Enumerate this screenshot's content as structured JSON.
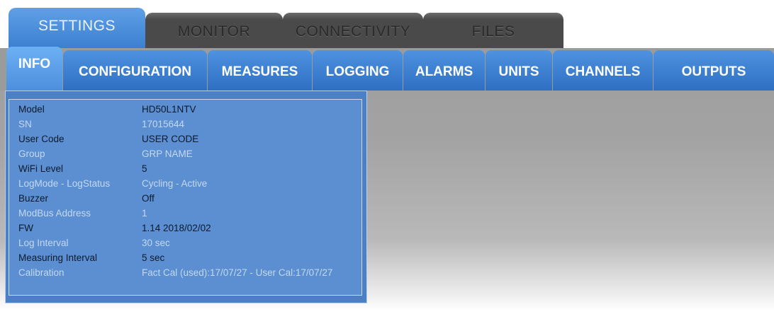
{
  "top_tabs": [
    {
      "label": "SETTINGS"
    },
    {
      "label": "MONITOR"
    },
    {
      "label": "CONNECTIVITY"
    },
    {
      "label": "FILES"
    }
  ],
  "sub_tabs": [
    {
      "label": "INFO"
    },
    {
      "label": "CONFIGURATION"
    },
    {
      "label": "MEASURES"
    },
    {
      "label": "LOGGING"
    },
    {
      "label": "ALARMS"
    },
    {
      "label": "UNITS"
    },
    {
      "label": "CHANNELS"
    },
    {
      "label": "OUTPUTS"
    }
  ],
  "info_rows": [
    {
      "label": "Model",
      "value": "HD50L1NTV"
    },
    {
      "label": "SN",
      "value": "17015644"
    },
    {
      "label": "User Code",
      "value": "USER CODE"
    },
    {
      "label": "Group",
      "value": "GRP NAME"
    },
    {
      "label": "WiFi Level",
      "value": "5"
    },
    {
      "label": "LogMode - LogStatus",
      "value": "Cycling - Active"
    },
    {
      "label": "Buzzer",
      "value": "Off"
    },
    {
      "label": "ModBus Address",
      "value": "1"
    },
    {
      "label": "FW",
      "value": "1.14 2018/02/02"
    },
    {
      "label": "Log Interval",
      "value": "30 sec"
    },
    {
      "label": "Measuring Interval",
      "value": "5 sec"
    },
    {
      "label": "Calibration",
      "value": "Fact Cal (used):17/07/27 - User Cal:17/07/27"
    }
  ],
  "colors": {
    "active_tab": "#4e92e0",
    "inactive_top_tab": "#4a4a4a",
    "panel_bg": "#5b8fd1",
    "dark_text": "#0c1a2e",
    "light_text": "#c4d8f1"
  }
}
